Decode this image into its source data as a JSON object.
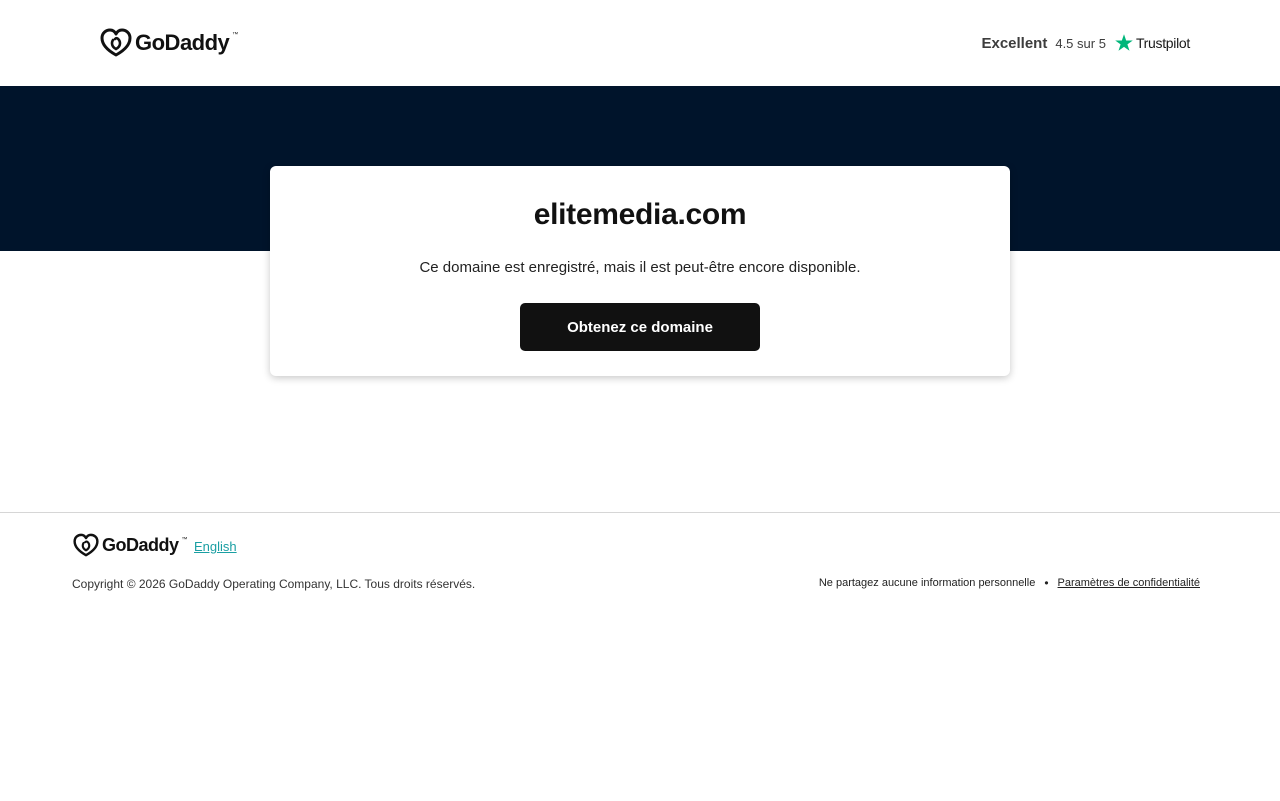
{
  "header": {
    "logo_text": "GoDaddy",
    "logo_tm": "™",
    "trustpilot": {
      "rating_word": "Excellent",
      "score": "4.5 sur 5",
      "brand": "Trustpilot",
      "star_color": "#00b67a"
    }
  },
  "card": {
    "domain": "elitemedia.com",
    "message": "Ce domaine est enregistré, mais il est peut-être encore disponible.",
    "cta_label": "Obtenez ce domaine"
  },
  "footer": {
    "logo_text": "GoDaddy",
    "logo_tm": "™",
    "language_link": "English",
    "copyright": "Copyright © 2026 GoDaddy Operating Company, LLC. Tous droits réservés.",
    "links": {
      "no_share": "Ne partagez aucune information personnelle",
      "separator": "•",
      "privacy": "Paramètres de confidentialité"
    }
  },
  "colors": {
    "band": "#00142b",
    "button": "#111111",
    "link": "#1a9fa3"
  },
  "icons": {
    "logo": "godaddy-logo-icon",
    "trustpilot_star": "star-icon"
  }
}
